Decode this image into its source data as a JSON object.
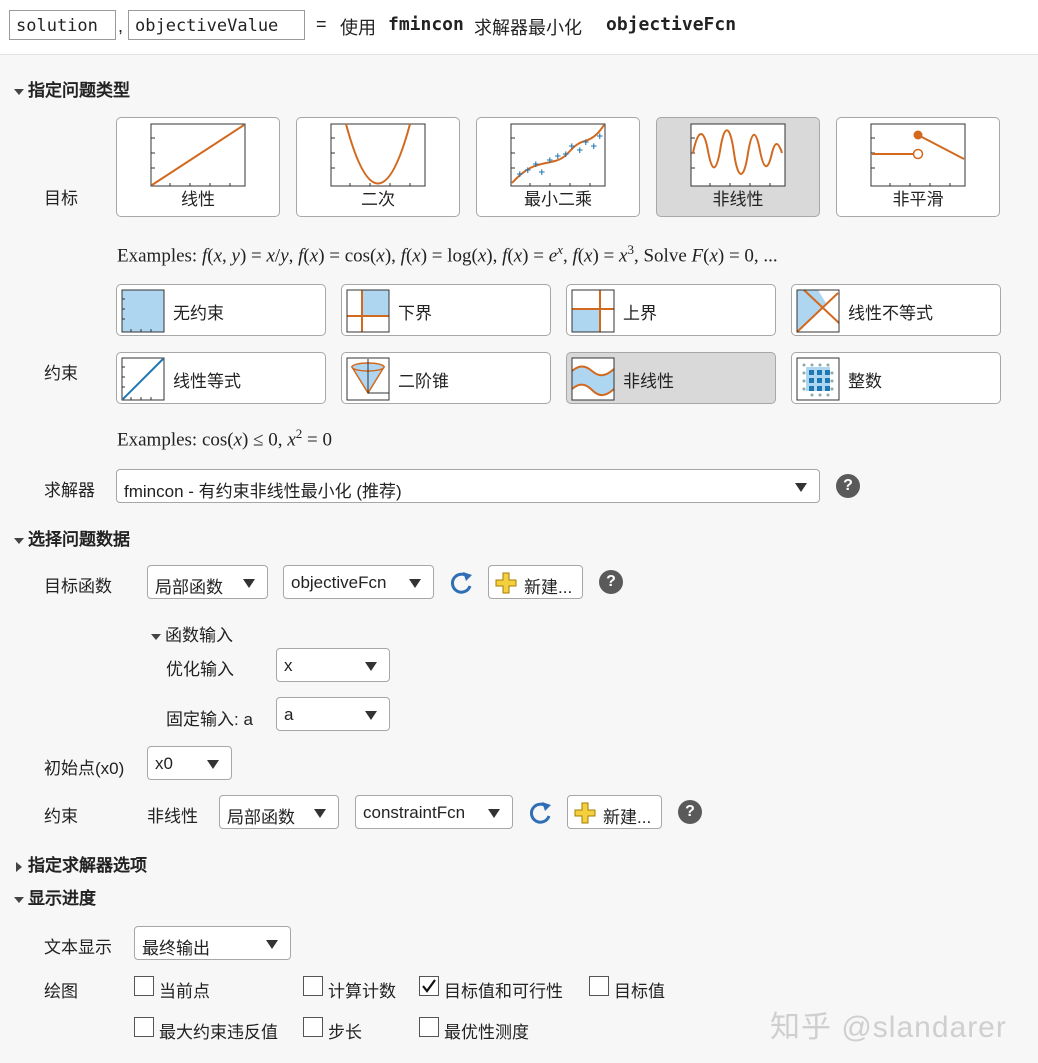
{
  "header": {
    "output1": "solution",
    "separator": ",",
    "output2": "objectiveValue",
    "equals": "=",
    "text_use": "使用",
    "solver": "fmincon",
    "text_mid": "求解器最小化",
    "fcn": "objectiveFcn"
  },
  "problem_type": {
    "title": "指定问题类型",
    "objective_label": "目标",
    "objective_types": [
      {
        "label": "线性",
        "selected": false
      },
      {
        "label": "二次",
        "selected": false
      },
      {
        "label": "最小二乘",
        "selected": false
      },
      {
        "label": "非线性",
        "selected": true
      },
      {
        "label": "非平滑",
        "selected": false
      }
    ],
    "objective_examples_prefix": "Examples:",
    "constraint_label": "约束",
    "constraint_types": [
      {
        "label": "无约束",
        "selected": false
      },
      {
        "label": "下界",
        "selected": false
      },
      {
        "label": "上界",
        "selected": false
      },
      {
        "label": "线性不等式",
        "selected": false
      },
      {
        "label": "线性等式",
        "selected": false
      },
      {
        "label": "二阶锥",
        "selected": false
      },
      {
        "label": "非线性",
        "selected": true
      },
      {
        "label": "整数",
        "selected": false
      }
    ],
    "constraint_examples_prefix": "Examples:",
    "solver_label": "求解器",
    "solver_value": "fmincon - 有约束非线性最小化 (推荐)"
  },
  "problem_data": {
    "title": "选择问题数据",
    "objective_fcn_label": "目标函数",
    "objective_source": "局部函数",
    "objective_fcn": "objectiveFcn",
    "new_label": "新建...",
    "fcn_inputs_title": "函数输入",
    "opt_input_label": "优化输入",
    "opt_input_value": "x",
    "fixed_input_label": "固定输入: a",
    "fixed_input_value": "a",
    "initial_point_label": "初始点(x0)",
    "initial_point_value": "x0",
    "constraint_label": "约束",
    "nonlinear_label": "非线性",
    "constraint_source": "局部函数",
    "constraint_fcn": "constraintFcn",
    "constraint_new_label": "新建..."
  },
  "solver_options": {
    "title": "指定求解器选项"
  },
  "display_progress": {
    "title": "显示进度",
    "text_display_label": "文本显示",
    "text_display_value": "最终输出",
    "plot_label": "绘图",
    "plots": [
      {
        "label": "当前点",
        "checked": false
      },
      {
        "label": "计算计数",
        "checked": false
      },
      {
        "label": "目标值和可行性",
        "checked": true
      },
      {
        "label": "目标值",
        "checked": false
      },
      {
        "label": "最大约束违反值",
        "checked": false
      },
      {
        "label": "步长",
        "checked": false
      },
      {
        "label": "最优性测度",
        "checked": false
      }
    ]
  },
  "watermark": "知乎 @slandarer",
  "colors": {
    "accent": "#d2691e",
    "fill": "#aed6f1",
    "teal": "#1f77b4",
    "selected_bg": "#d9d9d9"
  }
}
